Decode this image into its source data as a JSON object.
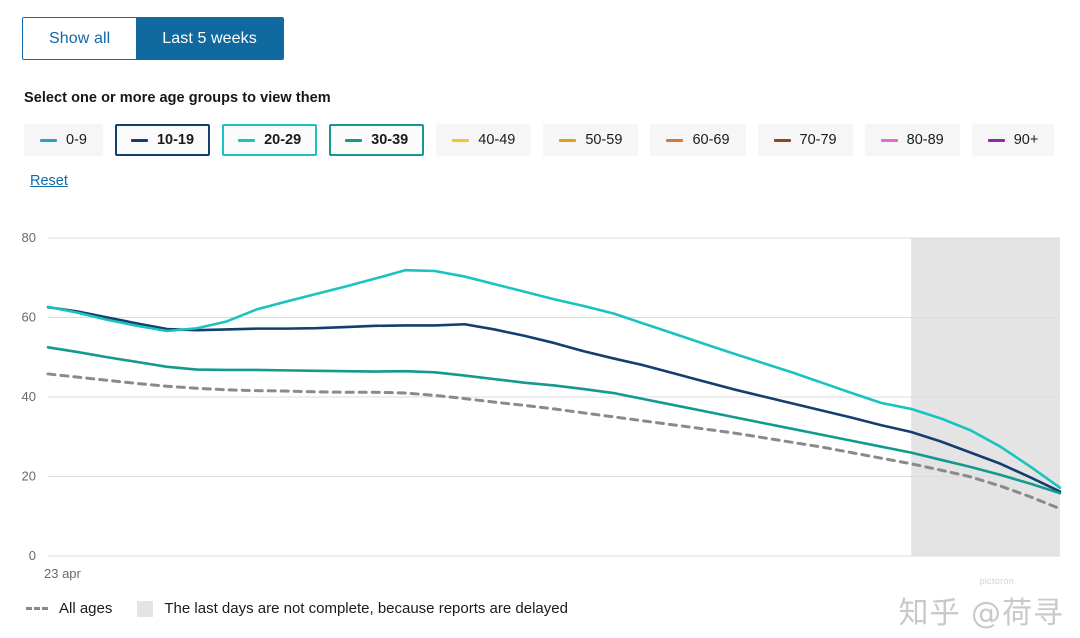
{
  "tabs": [
    {
      "label": "Show all",
      "active": false
    },
    {
      "label": "Last 5 weeks",
      "active": true
    }
  ],
  "select_heading": "Select one or more age groups to view them",
  "age_groups": [
    {
      "label": "0-9",
      "color": "#3099d9",
      "selected": false,
      "border": "#3099d9"
    },
    {
      "label": "10-19",
      "color": "#123f6d",
      "selected": true,
      "border": "#123f6d"
    },
    {
      "label": "20-29",
      "color": "#19c3bf",
      "selected": true,
      "border": "#19c3bf"
    },
    {
      "label": "30-39",
      "color": "#14998f",
      "selected": true,
      "border": "#14998f"
    },
    {
      "label": "40-49",
      "color": "#f2c531",
      "selected": false,
      "border": "#f2c531"
    },
    {
      "label": "50-59",
      "color": "#d9a217",
      "selected": false,
      "border": "#d9a217"
    },
    {
      "label": "60-69",
      "color": "#d4783c",
      "selected": false,
      "border": "#d4783c"
    },
    {
      "label": "70-79",
      "color": "#95451a",
      "selected": false,
      "border": "#95451a"
    },
    {
      "label": "80-89",
      "color": "#e268dd",
      "selected": false,
      "border": "#e268dd"
    },
    {
      "label": "90+",
      "color": "#8e2aa6",
      "selected": false,
      "border": "#8e2aa6"
    }
  ],
  "reset_label": "Reset",
  "footer": {
    "all_ages_label": "All ages",
    "incomplete_label": "The last days are not complete, because reports are delayed"
  },
  "watermark": {
    "text": "知乎 @荷寻",
    "sub": "pictoron"
  },
  "colors": {
    "accent": "#10699f",
    "gridline": "#dcdcdc",
    "incomplete_band": "#e4e4e4",
    "all_ages_dash": "#8a8a8a"
  },
  "chart_data": {
    "type": "line",
    "title": "",
    "xlabel": "",
    "ylabel": "",
    "ylim": [
      0,
      80
    ],
    "yticks": [
      0,
      20,
      40,
      60,
      80
    ],
    "grid": true,
    "legend_position": "top",
    "x_start_label": "23 apr",
    "xticks": [
      "23 apr"
    ],
    "x": [
      0,
      1,
      2,
      3,
      4,
      5,
      6,
      7,
      8,
      9,
      10,
      11,
      12,
      13,
      14,
      15,
      16,
      17,
      18,
      19,
      20,
      21,
      22,
      23,
      24,
      25,
      26,
      27,
      28,
      29,
      30,
      31,
      32,
      33,
      34
    ],
    "incomplete_region_start_x": 29,
    "incomplete_region_label": "The last days are not complete, because reports are delayed",
    "series": [
      {
        "name": "10-19",
        "color": "#123f6d",
        "style": "solid",
        "values": [
          62.6,
          61.5,
          60.0,
          58.5,
          57.1,
          56.8,
          57.0,
          57.2,
          57.2,
          57.3,
          57.6,
          57.9,
          58.0,
          58.0,
          58.3,
          57.0,
          55.4,
          53.6,
          51.5,
          49.7,
          48.0,
          46.0,
          44.0,
          42.0,
          40.2,
          38.4,
          36.6,
          34.8,
          32.9,
          31.2,
          28.8,
          26.0,
          23.2,
          19.8,
          16.2
        ]
      },
      {
        "name": "20-29",
        "color": "#19c3bf",
        "style": "solid",
        "values": [
          62.7,
          61.2,
          59.4,
          57.9,
          56.6,
          57.3,
          59.0,
          62.0,
          64.0,
          65.9,
          67.8,
          69.8,
          71.9,
          71.7,
          70.3,
          68.4,
          66.5,
          64.6,
          62.9,
          61.0,
          58.5,
          56.0,
          53.5,
          51.0,
          48.6,
          46.2,
          43.6,
          41.0,
          38.5,
          37.0,
          34.6,
          31.6,
          27.5,
          22.5,
          17.2
        ]
      },
      {
        "name": "30-39",
        "color": "#14998f",
        "style": "solid",
        "values": [
          52.5,
          51.3,
          50.0,
          48.8,
          47.6,
          46.9,
          46.8,
          46.8,
          46.7,
          46.6,
          46.5,
          46.4,
          46.5,
          46.2,
          45.4,
          44.5,
          43.6,
          42.9,
          42.0,
          41.0,
          39.5,
          38.0,
          36.5,
          35.0,
          33.5,
          32.0,
          30.5,
          29.0,
          27.5,
          26.0,
          24.2,
          22.4,
          20.4,
          18.2,
          15.8
        ]
      },
      {
        "name": "All ages",
        "color": "#8a8a8a",
        "style": "dashed",
        "values": [
          45.8,
          45.0,
          44.2,
          43.4,
          42.7,
          42.2,
          41.8,
          41.6,
          41.5,
          41.3,
          41.2,
          41.2,
          41.0,
          40.4,
          39.6,
          38.7,
          37.9,
          37.0,
          36.0,
          35.0,
          34.0,
          33.0,
          32.0,
          31.0,
          29.8,
          28.6,
          27.4,
          26.0,
          24.6,
          23.2,
          21.6,
          19.9,
          17.6,
          14.9,
          11.9
        ]
      }
    ]
  }
}
